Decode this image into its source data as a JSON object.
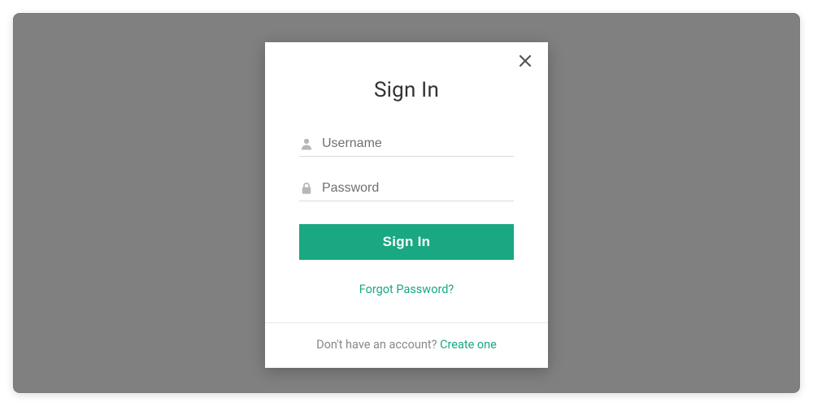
{
  "modal": {
    "title": "Sign In",
    "username": {
      "placeholder": "Username",
      "value": ""
    },
    "password": {
      "placeholder": "Password",
      "value": ""
    },
    "submit_label": "Sign In",
    "forgot_label": "Forgot Password?",
    "footer_prompt": "Don't have an account? ",
    "footer_link": "Create one"
  }
}
